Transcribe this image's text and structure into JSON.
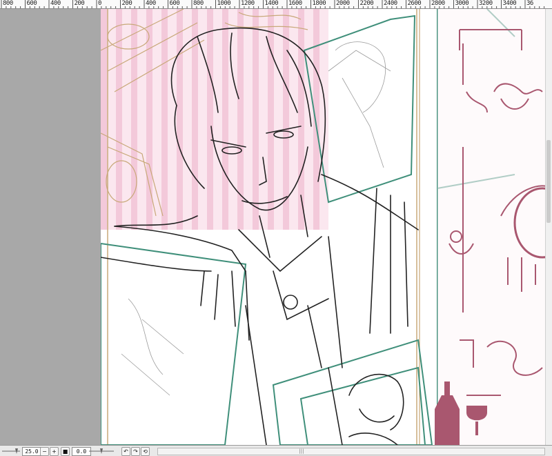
{
  "ruler": {
    "labels": [
      "800",
      "600",
      "400",
      "200",
      "0",
      "200",
      "400",
      "600",
      "800",
      "1000",
      "1200",
      "1400",
      "1600",
      "1800",
      "2000",
      "2200",
      "2400",
      "2600",
      "2800",
      "3000",
      "3200",
      "3400",
      "36"
    ]
  },
  "canvas": {
    "description_icon": "illustration-sketch",
    "colors": {
      "pink_stripe": "#f6d4e2",
      "frame_teal": "#3f8f7a",
      "ornament_rose": "#a9576f",
      "guide_tan": "#c8a878"
    }
  },
  "statusbar": {
    "zoom_value": "25.0",
    "rotation_value": "0.0",
    "zoom_out_icon": "zoom-out-icon",
    "zoom_in_icon": "zoom-in-icon",
    "fit_icon": "fit-screen-icon",
    "rotate_left_icon": "rotate-left-icon",
    "rotate_right_icon": "rotate-right-icon",
    "reset_icon": "reset-rotation-icon"
  }
}
